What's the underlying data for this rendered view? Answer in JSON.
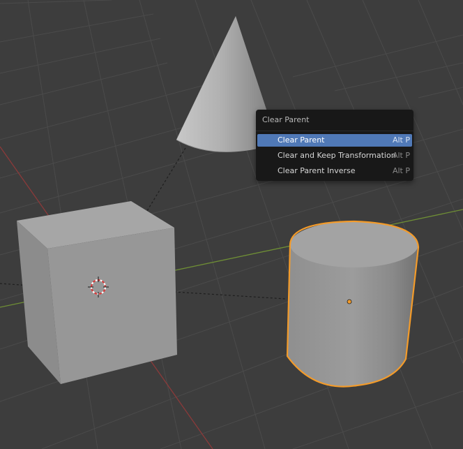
{
  "viewport": {
    "objects": {
      "cone": {
        "name": "cone"
      },
      "cube": {
        "name": "cube"
      },
      "cylinder": {
        "name": "cylinder",
        "selected": true
      }
    },
    "colors": {
      "background": "#3d3d3d",
      "grid": "#4a4a4a",
      "x_axis": "#8b3a3a",
      "y_axis": "#6f8f35",
      "selection_outline": "#f39b2a",
      "origin_dot": "#f39b2a",
      "object_gray": "#a9a9a9"
    },
    "icons": {
      "cursor": "3d-cursor-icon"
    }
  },
  "menu": {
    "title": "Clear Parent",
    "items": [
      {
        "label": "Clear Parent",
        "shortcut": "Alt P",
        "active": true
      },
      {
        "label": "Clear and Keep Transformation",
        "shortcut": "Alt P",
        "active": false
      },
      {
        "label": "Clear Parent Inverse",
        "shortcut": "Alt P",
        "active": false
      }
    ]
  }
}
